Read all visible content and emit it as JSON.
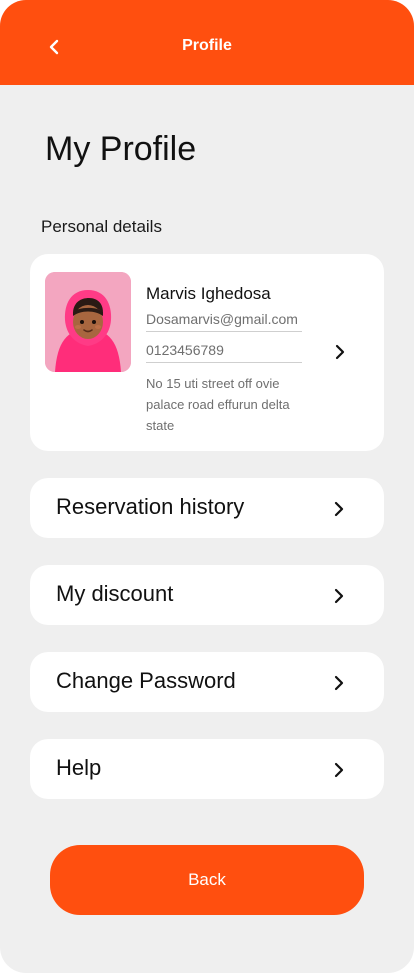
{
  "header": {
    "title": "Profile",
    "back_icon": "chevron-left-icon",
    "background_color": "#ff4f0f"
  },
  "page": {
    "title": "My Profile",
    "section_label": "Personal details"
  },
  "profile": {
    "name": "Marvis Ighedosa",
    "email": "Dosamarvis@gmail.com",
    "phone": "0123456789",
    "address": "No 15 uti street off ovie palace road effurun delta state",
    "avatar_icon": "user-avatar",
    "chevron_icon": "chevron-right-icon"
  },
  "menu": [
    {
      "label": "Reservation history",
      "icon": "chevron-right-icon"
    },
    {
      "label": "My discount",
      "icon": "chevron-right-icon"
    },
    {
      "label": "Change Password",
      "icon": "chevron-right-icon"
    },
    {
      "label": "Help",
      "icon": "chevron-right-icon"
    }
  ],
  "footer": {
    "back_label": "Back",
    "accent_color": "#ff4f0f"
  }
}
